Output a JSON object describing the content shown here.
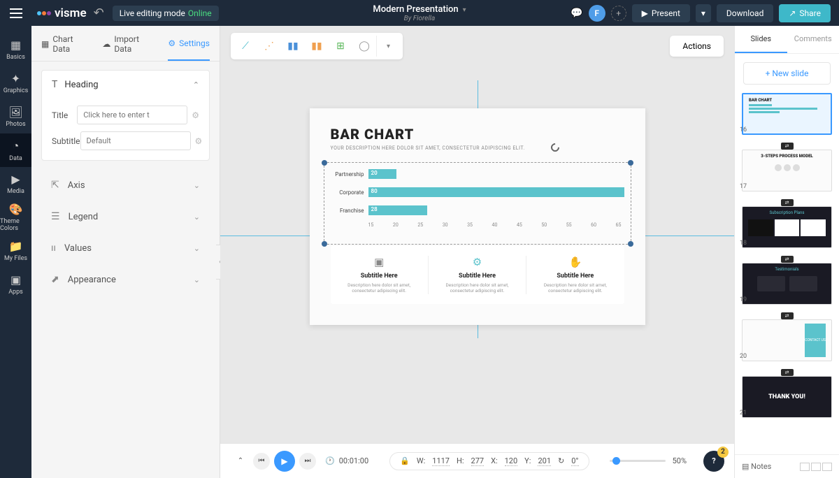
{
  "header": {
    "brand": "visme",
    "edit_mode_label": "Live editing mode",
    "edit_mode_status": "Online",
    "project_title": "Modern Presentation",
    "project_author": "By Fiorella",
    "avatar_initial": "F",
    "present_label": "Present",
    "download_label": "Download",
    "share_label": "Share"
  },
  "leftnav": {
    "items": [
      "Basics",
      "Graphics",
      "Photos",
      "Data",
      "Media",
      "Theme Colors",
      "My Files",
      "Apps"
    ],
    "active_index": 3
  },
  "sidepanel": {
    "tabs": {
      "chart_data": "Chart Data",
      "import_data": "Import Data",
      "settings": "Settings"
    },
    "heading_section": "Heading",
    "title_label": "Title",
    "title_placeholder": "Click here to enter t",
    "subtitle_label": "Subtitle",
    "subtitle_placeholder": "Default",
    "sections": {
      "axis": "Axis",
      "legend": "Legend",
      "values": "Values",
      "appearance": "Appearance"
    }
  },
  "canvas": {
    "actions_label": "Actions",
    "slide": {
      "title": "BAR CHART",
      "desc": "YOUR DESCRIPTION HERE DOLOR SIT AMET, CONSECTETUR ADIPISCING ELIT.",
      "footer_title": "Subtitle Here",
      "footer_desc": "Description here dolor sit amet, consectetur adipiscing elit."
    }
  },
  "chart_data": {
    "type": "bar",
    "orientation": "horizontal",
    "categories": [
      "Partnership",
      "Corporate",
      "Franchise"
    ],
    "values": [
      20,
      80,
      28
    ],
    "ticks": [
      15,
      20,
      25,
      30,
      35,
      40,
      45,
      50,
      55,
      60,
      65
    ],
    "color": "#5bc3cc"
  },
  "bottombar": {
    "time": "00:01:00",
    "w_label": "W:",
    "w": "1117",
    "h_label": "H:",
    "h": "277",
    "x_label": "X:",
    "x": "120",
    "y_label": "Y:",
    "y": "201",
    "rot_label": "",
    "rot": "0°",
    "zoom": "50%",
    "help_badge": "2"
  },
  "rightrail": {
    "tab_slides": "Slides",
    "tab_comments": "Comments",
    "new_slide": "New slide",
    "thumbs": [
      {
        "num": "16",
        "title": "BAR CHART",
        "sel": true
      },
      {
        "num": "17",
        "title": "3-STEPS PROCESS MODEL"
      },
      {
        "num": "18",
        "title": "Subscription Plans",
        "dark": true
      },
      {
        "num": "19",
        "title": "Testimonials",
        "dark": true
      },
      {
        "num": "20",
        "title": "CONTACT US"
      },
      {
        "num": "21",
        "title": "THANK YOU!",
        "dark": true
      }
    ],
    "notes_label": "Notes"
  }
}
